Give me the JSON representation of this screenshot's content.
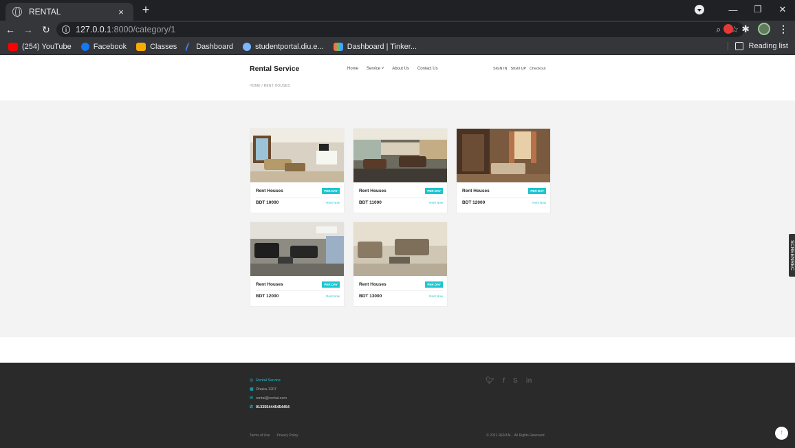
{
  "browser": {
    "tab_title": "RENTAL",
    "tab_close": "×",
    "new_tab": "+",
    "url_host": "127.0.0.1",
    "url_path": ":8000/category/1",
    "bookmarks": [
      {
        "label": "(254) YouTube",
        "icon": "youtube-icon",
        "color": "#ff0000"
      },
      {
        "label": "Facebook",
        "icon": "facebook-icon",
        "color": "#1877f2"
      },
      {
        "label": "Classes",
        "icon": "classroom-icon",
        "color": "#f9ab00"
      },
      {
        "label": "Dashboard",
        "icon": "dashboard-icon",
        "color": "#4285f4"
      },
      {
        "label": "studentportal.diu.e...",
        "icon": "student-portal-icon",
        "color": "#7cb6ff"
      },
      {
        "label": "Dashboard | Tinker...",
        "icon": "tinkercad-icon",
        "color": "#ff7043"
      }
    ],
    "reading_list": "Reading list"
  },
  "site": {
    "brand": "Rental Service",
    "nav": [
      "Home",
      "Service ˅",
      "About Us",
      "Contact Us"
    ],
    "auth": [
      "SIGN IN",
      "SIGN UP",
      "Checkout"
    ],
    "breadcrumb": "HOME / RENT HOUSES",
    "accent_color": "#1cc7d0"
  },
  "cards": [
    {
      "title": "Rent Houses",
      "badge": "PER DAY",
      "price": "BDT 10000",
      "action": "Rent Now"
    },
    {
      "title": "Rent Houses",
      "badge": "PER DAY",
      "price": "BDT 11000",
      "action": "Rent Now"
    },
    {
      "title": "Rent Houses",
      "badge": "PER DAY",
      "price": "BDT 12000",
      "action": "Rent Now"
    },
    {
      "title": "Rent Houses",
      "badge": "PER DAY",
      "price": "BDT 12000",
      "action": "Rent Now"
    },
    {
      "title": "Rent Houses",
      "badge": "PER DAY",
      "price": "BDT 13000",
      "action": "Rent Now"
    }
  ],
  "footer": {
    "brand": "Rental Service",
    "address": "Dhaka-1207",
    "email": "rental@rental.com",
    "phone": "0133554445454454",
    "social": [
      "twitter-icon",
      "facebook-icon",
      "skype-icon",
      "linkedin-icon"
    ],
    "links": [
      "Terms of Use",
      "Privacy Policy"
    ],
    "copyright": "© 2021 RENTAL . All Rights Reserved"
  },
  "side_widget": "SCREENREC"
}
